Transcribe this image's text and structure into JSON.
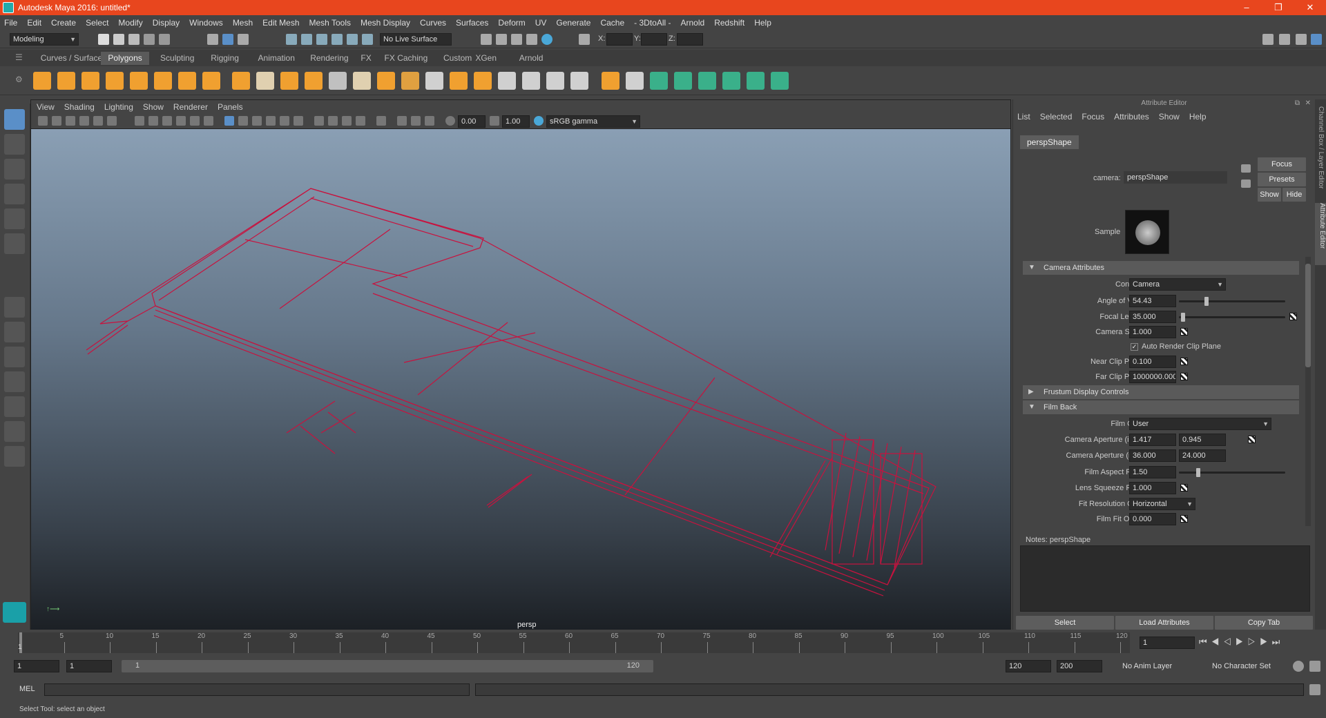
{
  "window": {
    "title": "Autodesk Maya 2016: untitled*",
    "minimize": "–",
    "maximize": "❐",
    "close": "✕"
  },
  "menubar": [
    "File",
    "Edit",
    "Create",
    "Select",
    "Modify",
    "Display",
    "Windows",
    "Mesh",
    "Edit Mesh",
    "Mesh Tools",
    "Mesh Display",
    "Curves",
    "Surfaces",
    "Deform",
    "UV",
    "Generate",
    "Cache",
    "- 3DtoAll -",
    "Arnold",
    "Redshift",
    "Help"
  ],
  "status": {
    "mode": "Modeling",
    "live_surface": "No Live Surface",
    "x_label": "X:",
    "y_label": "Y:",
    "z_label": "Z:"
  },
  "shelf_tabs": [
    "Curves / Surfaces",
    "Polygons",
    "Sculpting",
    "Rigging",
    "Animation",
    "Rendering",
    "FX",
    "FX Caching",
    "Custom",
    "XGen",
    "Arnold"
  ],
  "shelf_active": "Polygons",
  "viewport": {
    "menu": [
      "View",
      "Shading",
      "Lighting",
      "Show",
      "Renderer",
      "Panels"
    ],
    "exposure": "0.00",
    "gamma": "1.00",
    "color_space": "sRGB gamma",
    "camera_label": "persp",
    "wire_color": "#c8123e"
  },
  "attribute_editor": {
    "title": "Attribute Editor",
    "menu": [
      "List",
      "Selected",
      "Focus",
      "Attributes",
      "Show",
      "Help"
    ],
    "tab": "perspShape",
    "camera_label": "camera:",
    "camera_value": "perspShape",
    "focus_btn": "Focus",
    "presets_btn": "Presets",
    "show_btn": "Show",
    "hide_btn": "Hide",
    "sample_label": "Sample",
    "camera_attributes": "Camera Attributes",
    "controls_label": "Controls",
    "controls_value": "Camera",
    "angle_label": "Angle of View",
    "angle_value": "54.43",
    "angle_fraction": 0.25,
    "focal_label": "Focal Length",
    "focal_value": "35.000",
    "focal_fraction": 0.02,
    "scale_label": "Camera Scale",
    "scale_value": "1.000",
    "auto_clip": "Auto Render Clip Plane",
    "near_label": "Near Clip Plane",
    "near_value": "0.100",
    "far_label": "Far Clip Plane",
    "far_value": "1000000.000",
    "frustum": "Frustum Display Controls",
    "film_back": "Film Back",
    "gate_label": "Film Gate",
    "gate_value": "User",
    "ap_inch_label": "Camera Aperture (inch)",
    "ap_inch_x": "1.417",
    "ap_inch_y": "0.945",
    "ap_mm_label": "Camera Aperture (mm)",
    "ap_mm_x": "36.000",
    "ap_mm_y": "24.000",
    "aspect_label": "Film Aspect Ratio",
    "aspect_value": "1.50",
    "aspect_fraction": 0.17,
    "squeeze_label": "Lens Squeeze Ratio",
    "squeeze_value": "1.000",
    "fitres_label": "Fit Resolution Gate",
    "fitres_value": "Horizontal",
    "fitoff_label": "Film Fit Offset",
    "fitoff_value": "0.000",
    "notes_label": "Notes:  perspShape",
    "select_btn": "Select",
    "load_btn": "Load Attributes",
    "copy_btn": "Copy Tab"
  },
  "side_tabs": [
    "Channel Box / Layer Editor",
    "Attribute Editor"
  ],
  "timeline": {
    "ticks": [
      "5",
      "10",
      "15",
      "20",
      "25",
      "30",
      "35",
      "40",
      "45",
      "50",
      "55",
      "60",
      "65",
      "70",
      "75",
      "80",
      "85",
      "90",
      "95",
      "100",
      "105",
      "110",
      "115",
      "120"
    ],
    "start": "1",
    "current": "1"
  },
  "range": {
    "start": "1",
    "anim_start": "1",
    "range_start": "1",
    "range_end": "120",
    "end": "120",
    "anim_end": "200",
    "anim_layer": "No Anim Layer",
    "char_set": "No Character Set"
  },
  "cmd": {
    "lang": "MEL",
    "help": "Select Tool: select an object"
  }
}
